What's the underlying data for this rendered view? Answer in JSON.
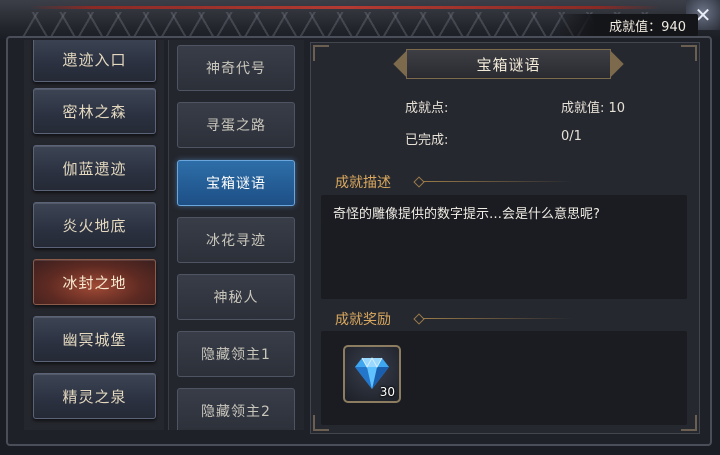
{
  "header": {
    "achievement_score": "成就值：940",
    "close_icon": "close-icon"
  },
  "categories": [
    {
      "label": "遗迹入口",
      "active": false
    },
    {
      "label": "密林之森",
      "active": false
    },
    {
      "label": "伽蓝遗迹",
      "active": false
    },
    {
      "label": "炎火地底",
      "active": false
    },
    {
      "label": "冰封之地",
      "active": true
    },
    {
      "label": "幽冥城堡",
      "active": false
    },
    {
      "label": "精灵之泉",
      "active": false
    }
  ],
  "achievements": [
    {
      "label": "神奇代号",
      "active": false
    },
    {
      "label": "寻蛋之路",
      "active": false
    },
    {
      "label": "宝箱谜语",
      "active": true
    },
    {
      "label": "冰花寻迹",
      "active": false
    },
    {
      "label": "神秘人",
      "active": false
    },
    {
      "label": "隐藏领主1",
      "active": false
    },
    {
      "label": "隐藏领主2",
      "active": false
    }
  ],
  "detail": {
    "title": "宝箱谜语",
    "points_label": "成就点:",
    "score_label": "成就值: 10",
    "completed_label": "已完成:",
    "completed_value": "0/1",
    "description_heading": "成就描述",
    "description": "奇怪的雕像提供的数字提示…会是什么意思呢?",
    "reward_heading": "成就奖励",
    "reward": {
      "icon": "diamond-icon",
      "count": "30"
    }
  },
  "colors": {
    "accent_gold": "#d9a85e",
    "active_tab_blue": "#2e6ea8",
    "active_category_red": "#a04a35"
  }
}
